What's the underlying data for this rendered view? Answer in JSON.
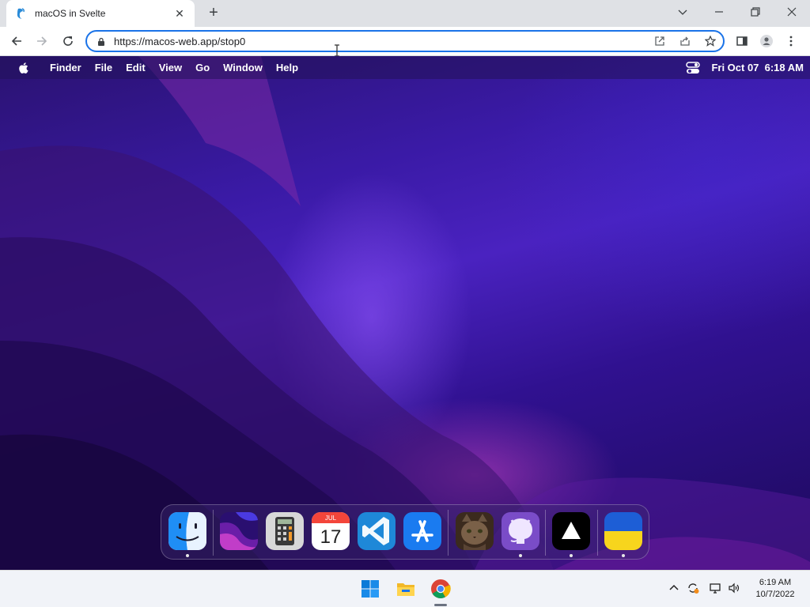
{
  "browser": {
    "tab_title": "macOS in Svelte",
    "url": "https://macos-web.app/stop0"
  },
  "menubar": {
    "app_name": "Finder",
    "items": [
      "File",
      "Edit",
      "View",
      "Go",
      "Window",
      "Help"
    ],
    "datetime": "Fri Oct 07  6:18 AM"
  },
  "dock": {
    "apps": [
      {
        "icon": "finder-icon",
        "running": true
      },
      {
        "icon": "wallpapers-icon",
        "running": false
      },
      {
        "icon": "calculator-icon",
        "running": false
      },
      {
        "icon": "calendar-icon",
        "running": false,
        "month": "JUL",
        "day": "17"
      },
      {
        "icon": "vscode-icon",
        "running": false
      },
      {
        "icon": "app-store-icon",
        "running": false
      },
      {
        "icon": "cat-photo-icon",
        "running": false
      },
      {
        "icon": "github-icon",
        "running": true
      },
      {
        "icon": "vercel-icon",
        "running": true
      },
      {
        "icon": "ukraine-flag-icon",
        "running": true
      }
    ]
  },
  "taskbar": {
    "apps": [
      "windows-start-icon",
      "file-explorer-icon",
      "chrome-icon"
    ],
    "clock_time": "6:19 AM",
    "clock_date": "10/7/2022"
  },
  "colors": {
    "omnibox_focus": "#1a73e8",
    "wallpaper_base": "#3a1aa6",
    "wallpaper_glow": "#d246c8"
  }
}
